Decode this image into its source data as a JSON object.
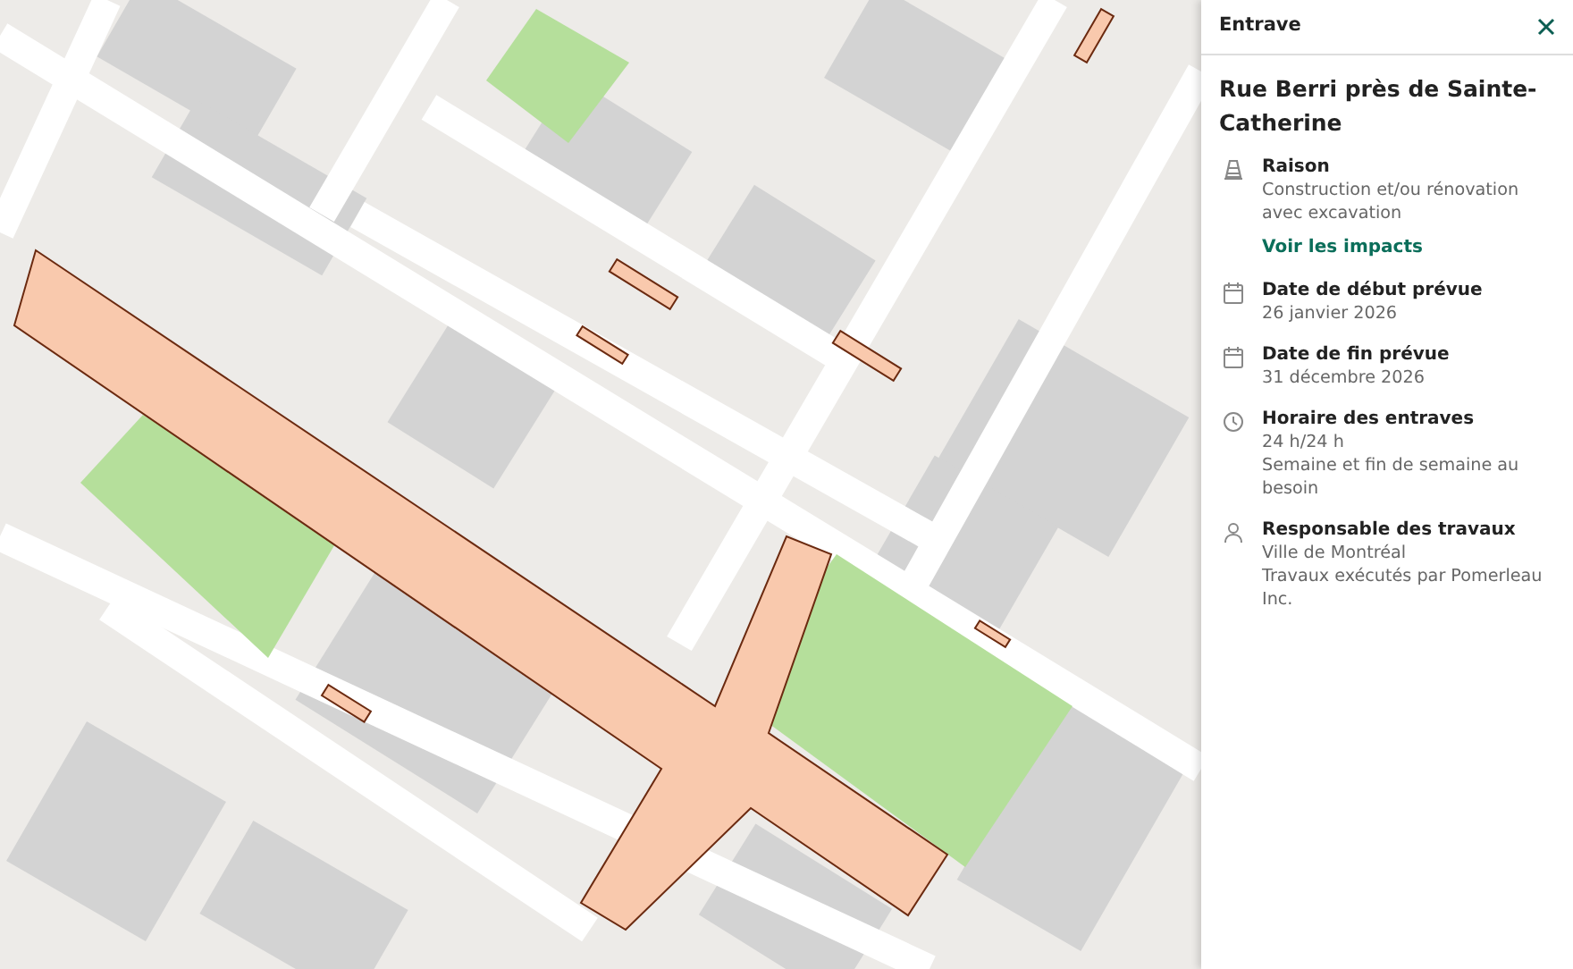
{
  "panel": {
    "header": "Entrave",
    "title": "Rue Berri près de Sainte-Catherine",
    "items": [
      {
        "kind": "cone",
        "label": "Raison",
        "lines": [
          "Construction et/ou rénovation avec excavation"
        ],
        "link": "Voir les impacts"
      },
      {
        "kind": "calendar",
        "label": "Date de début prévue",
        "lines": [
          "26 janvier 2026"
        ]
      },
      {
        "kind": "calendar",
        "label": "Date de fin prévue",
        "lines": [
          "31 décembre 2026"
        ]
      },
      {
        "kind": "clock",
        "label": "Horaire des entraves",
        "lines": [
          "24 h/24 h",
          "Semaine et fin de semaine au besoin"
        ]
      },
      {
        "kind": "person",
        "label": "Responsable des travaux",
        "lines": [
          "Ville de Montréal",
          "Travaux exécutés par Pomerleau Inc."
        ]
      }
    ]
  }
}
